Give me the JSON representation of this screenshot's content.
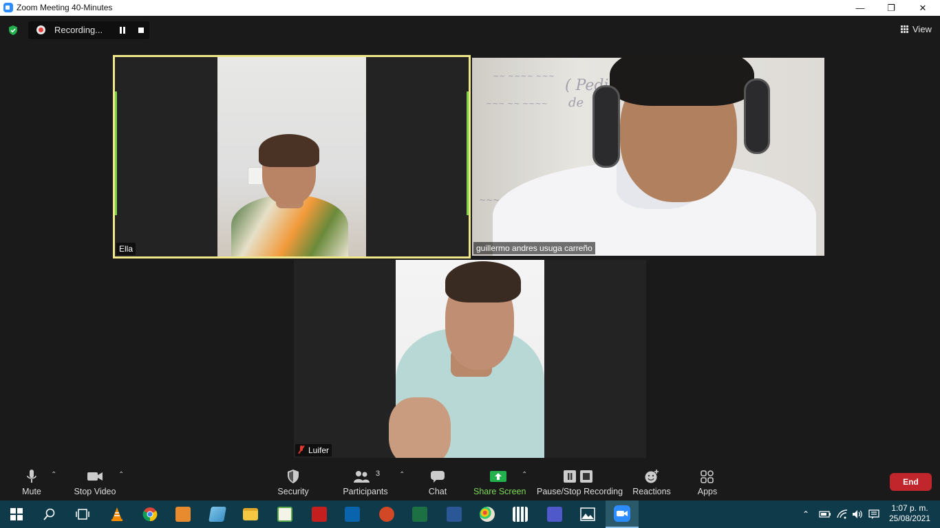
{
  "window": {
    "title": "Zoom Meeting 40-Minutes"
  },
  "top_bar": {
    "recording_label": "Recording...",
    "view_label": "View"
  },
  "participants": [
    {
      "name": "Ella",
      "active_speaker": true
    },
    {
      "name": "guillermo andres usuga carreño",
      "active_speaker": false
    },
    {
      "name": "Luifer",
      "muted": true
    }
  ],
  "controls": {
    "mute": "Mute",
    "stop_video": "Stop Video",
    "security": "Security",
    "participants": "Participants",
    "participants_count": "3",
    "chat": "Chat",
    "share_screen": "Share Screen",
    "pause_stop_recording": "Pause/Stop Recording",
    "reactions": "Reactions",
    "apps": "Apps",
    "end": "End"
  },
  "taskbar": {
    "apps": [
      "start",
      "search",
      "task-view",
      "vlc",
      "chrome",
      "media-player",
      "notepad",
      "file-explorer",
      "pictures",
      "acrobat",
      "outlook",
      "powerpoint",
      "excel",
      "word",
      "paint",
      "calculator",
      "teams",
      "photos",
      "zoom"
    ],
    "time": "1:07 p. m.",
    "date": "25/08/2021"
  },
  "colors": {
    "active_speaker_border": "#f0e78a",
    "end_button": "#c0262b",
    "share_screen": "#7ed957",
    "taskbar": "#0e3a4a"
  }
}
